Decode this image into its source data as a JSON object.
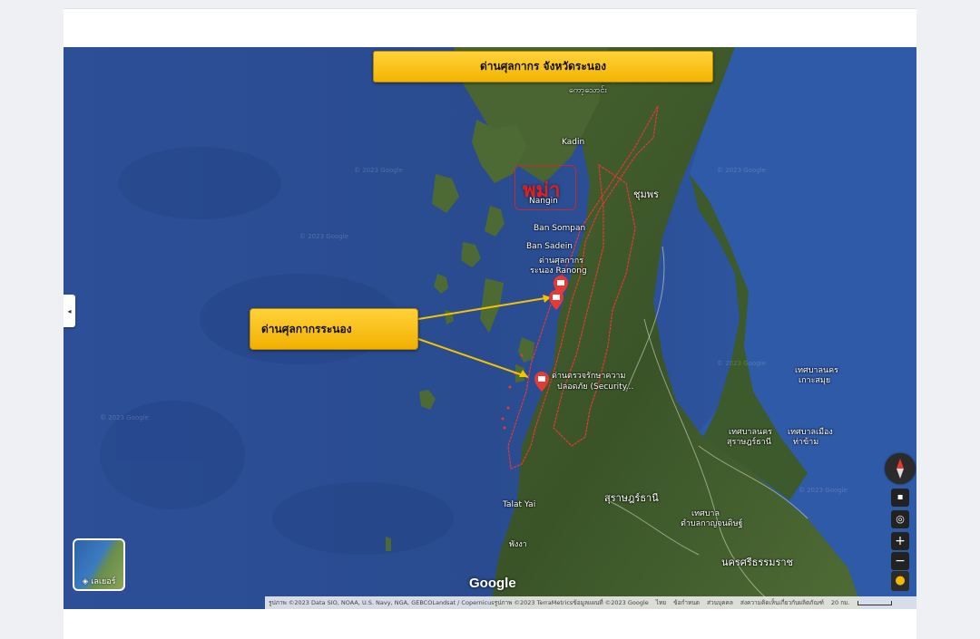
{
  "title_banner": "ด่านศุลกากร จังหวัดระนอง",
  "callout": "ด่านศุลกากรระนอง",
  "city_marker": "พม่า",
  "places": {
    "kawthaung": "ကော့သောင်း",
    "kadin": "Kadin",
    "nangin": "Nangin",
    "ban_sompan": "Ban Sompan",
    "ban_sadein": "Ban Sadein",
    "customs_label_1": "ด่านศุลกากร",
    "customs_label_2": "ระนอง Ranong",
    "security_label_1": "ด่านตรวจรักษาความ",
    "security_label_2": "ปลอดภัย (Security...",
    "chumphon": "ชุมพร",
    "surat_thani": "สุราษฎร์ธานี",
    "talat_yai": "Talat Yai",
    "phang_nga": "พังงา",
    "nakhon_si": "นครศรีธรรมราช",
    "samui_1": "เทศบาลนคร",
    "samui_2": "เกาะสมุย",
    "pacific_1": "เทศบาลนคร",
    "pacific_2": "สุราษฎร์ธานี",
    "tha_chang_1": "เทศบาลเมือง",
    "tha_chang_2": "ท่าข้าม",
    "kanchanadit_1": "เทศบาล",
    "kanchanadit_2": "ตำบลกาญจนดิษฐ์"
  },
  "watermark": "© 2023 Google",
  "layers_label": "เลเยอร์",
  "google_logo": "Google",
  "attribution": {
    "imagery": "รูปภาพ ©2023 Data SIO, NOAA, U.S. Navy, NGA, GEBCOLandsat / Copernicusรูปภาพ ©2023 TerraMetricsข้อมูลแผนที่ ©2023 Google",
    "lang": "ไทย",
    "terms": "ข้อกำหนด",
    "privacy": "ส่วนบุคคล",
    "feedback": "ส่งความคิดเห็นเกี่ยวกับผลิตภัณฑ์",
    "scale": "20 กม."
  },
  "controls": {
    "compass": "compass",
    "zoom_in": "+",
    "zoom_out": "−"
  },
  "colors": {
    "ocean": "#2a4f9a",
    "land": "#3e5a2a",
    "banner": "#f5b800",
    "boundary": "#e53935"
  }
}
